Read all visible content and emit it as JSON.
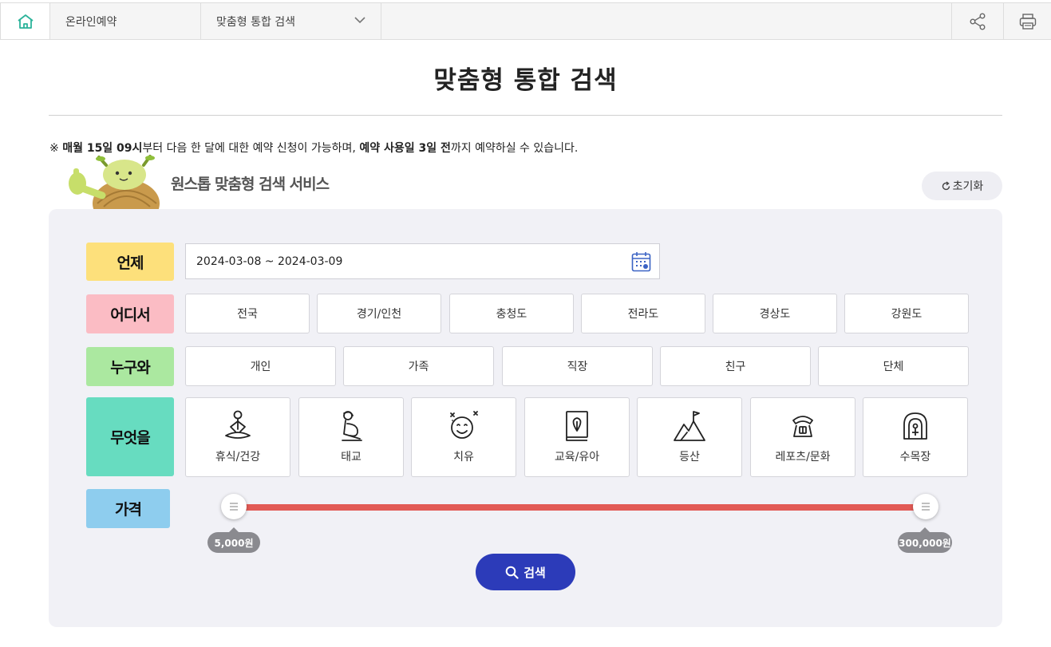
{
  "nav": {
    "breadcrumb_1": "온라인예약",
    "breadcrumb_2": "맞춤형 통합 검색"
  },
  "page": {
    "title": "맞춤형 통합 검색",
    "notice_prefix": "※ ",
    "notice_bold1": "매월 15일 09시",
    "notice_mid1": "부터 다음 한 달에 대한 예약 신청이 가능하며, ",
    "notice_bold2": "예약 사용일 3일 전",
    "notice_end": "까지 예약하실 수 있습니다."
  },
  "service": {
    "title": "원스톱 맞춤형 검색 서비스",
    "reset_label": "초기화"
  },
  "labels": {
    "when": "언제",
    "where": "어디서",
    "who": "누구와",
    "what": "무엇을",
    "price": "가격"
  },
  "when": {
    "date_range": "2024-03-08 ~ 2024-03-09"
  },
  "where_options": [
    "전국",
    "경기/인천",
    "충청도",
    "전라도",
    "경상도",
    "강원도"
  ],
  "who_options": [
    "개인",
    "가족",
    "직장",
    "친구",
    "단체"
  ],
  "what_options": [
    {
      "label": "휴식/건강",
      "icon": "meditation-icon"
    },
    {
      "label": "태교",
      "icon": "pregnant-icon"
    },
    {
      "label": "치유",
      "icon": "smile-icon"
    },
    {
      "label": "교육/유아",
      "icon": "book-icon"
    },
    {
      "label": "등산",
      "icon": "mountain-flag-icon"
    },
    {
      "label": "레포츠/문화",
      "icon": "leisure-icon"
    },
    {
      "label": "수목장",
      "icon": "tree-burial-icon"
    }
  ],
  "price": {
    "min_label": "5,000원",
    "max_label": "300,000원",
    "min_value": 5000,
    "max_value": 300000
  },
  "search": {
    "label": "검색"
  },
  "colors": {
    "accent": "#2c3bb9",
    "slider": "#e25a55",
    "when": "#fde07b",
    "where": "#fbbcc4",
    "who": "#abe8a0",
    "what": "#67dcc0",
    "price": "#8ecdee"
  }
}
